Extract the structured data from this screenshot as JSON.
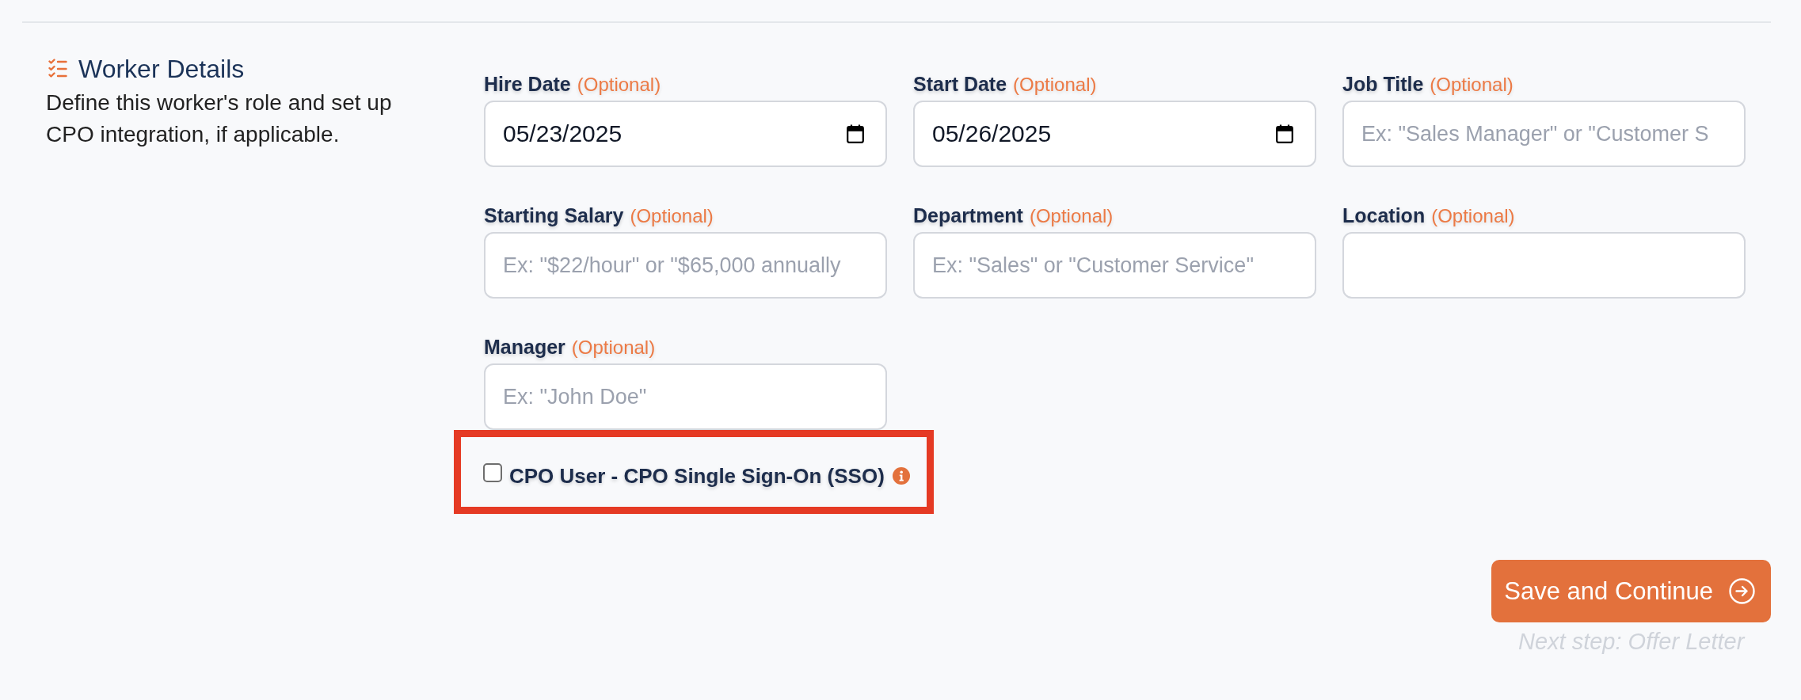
{
  "section": {
    "title": "Worker Details",
    "description": "Define this worker's role and set up CPO integration, if applicable."
  },
  "fields": [
    {
      "kind": "date",
      "label": "Hire Date",
      "hint": "(Optional)",
      "value": "05/23/2025"
    },
    {
      "kind": "date",
      "label": "Start Date",
      "hint": "(Optional)",
      "value": "05/26/2025"
    },
    {
      "kind": "text",
      "label": "Job Title",
      "hint": "(Optional)",
      "placeholder": "Ex: \"Sales Manager\" or \"Customer S"
    },
    {
      "kind": "text",
      "label": "Starting Salary",
      "hint": "(Optional)",
      "placeholder": "Ex: \"$22/hour\" or \"$65,000 annually"
    },
    {
      "kind": "text",
      "label": "Department",
      "hint": "(Optional)",
      "placeholder": "Ex: \"Sales\" or \"Customer Service\""
    },
    {
      "kind": "text",
      "label": "Location",
      "hint": "(Optional)"
    },
    {
      "kind": "text",
      "label": "Manager",
      "hint": "(Optional)",
      "placeholder": "Ex: \"John Doe\""
    }
  ],
  "sso": {
    "label": "CPO User - CPO Single Sign-On (SSO)",
    "checked": false,
    "highlighted": true
  },
  "actions": {
    "primary": "Save and Continue",
    "next_step": "Next step: Offer Letter"
  }
}
